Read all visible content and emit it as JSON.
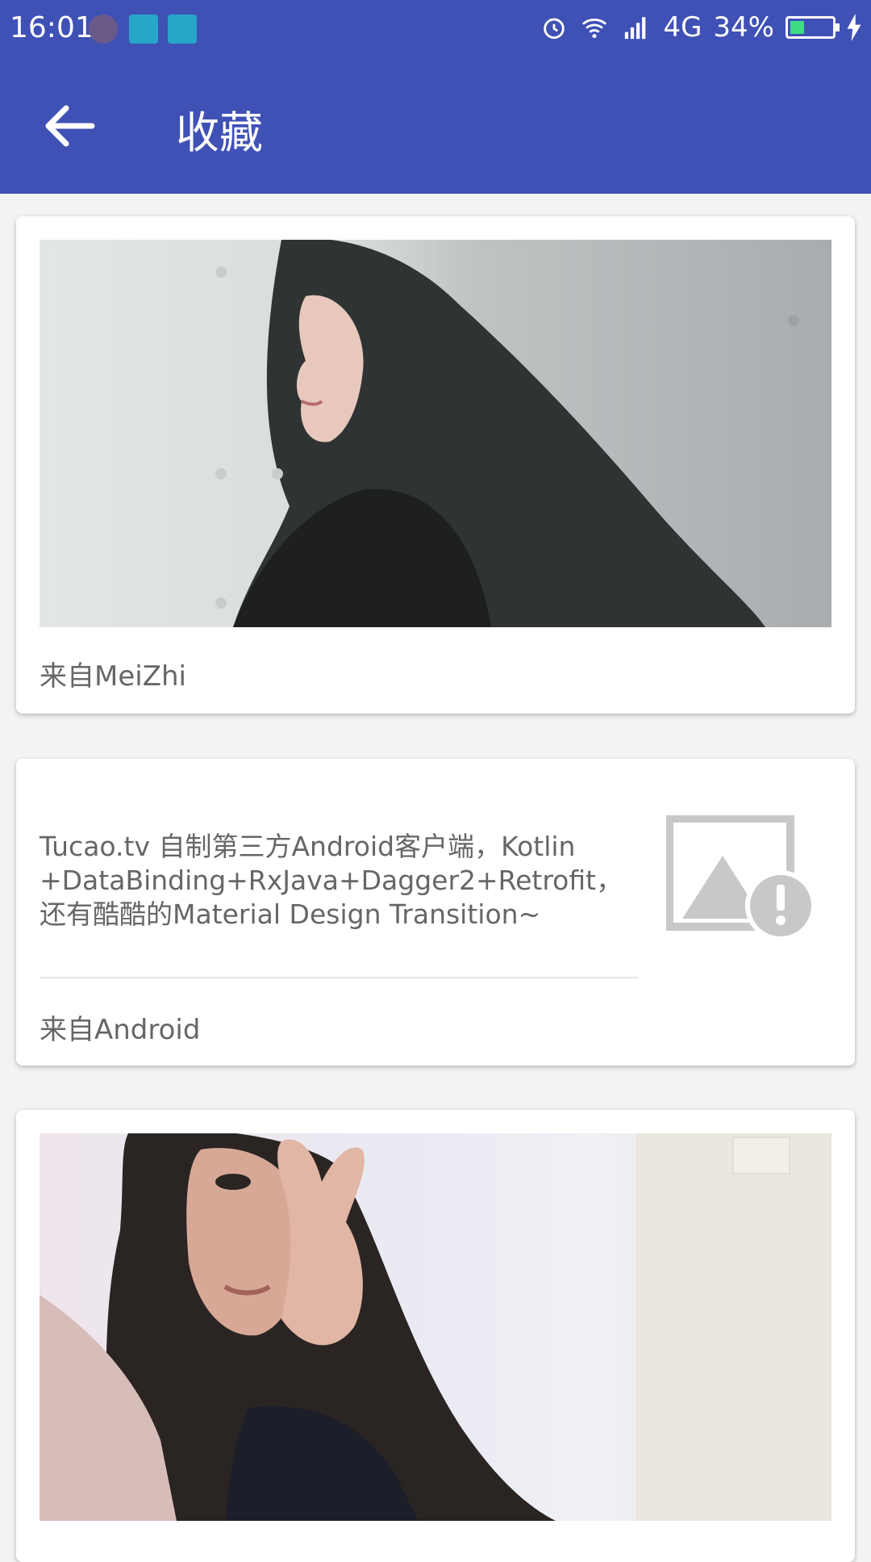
{
  "status_bar": {
    "time": "16:01",
    "network": "4G",
    "battery": "34%",
    "battery_level": 0.34,
    "icons": [
      "app-icon",
      "screenshot-icon",
      "usb-icon",
      "alarm-icon",
      "wifi-icon",
      "signal-icon",
      "battery-icon",
      "charging-icon"
    ],
    "bg_color": "#3f51b5"
  },
  "toolbar": {
    "title": "收藏",
    "back_icon": "back-arrow-icon",
    "bg_color": "#3f51b5"
  },
  "cards": [
    {
      "type": "image",
      "source": "来自MeiZhi"
    },
    {
      "type": "text",
      "description": "Tucao.tv 自制第三方Android客户端，Kotlin +DataBinding+RxJava+Dagger2+Retrofit，还有酷酷的Material Design Transition~",
      "thumbnail_icon": "broken-image-icon",
      "source": "来自Android"
    },
    {
      "type": "image"
    }
  ]
}
